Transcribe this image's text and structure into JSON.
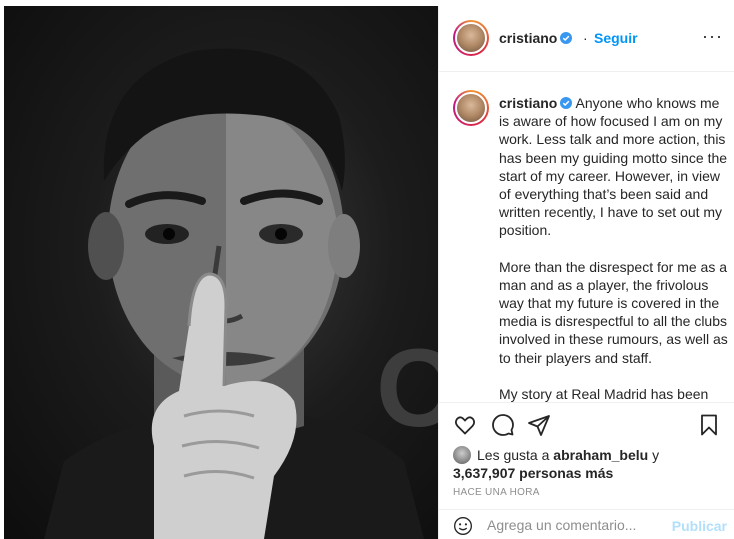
{
  "post": {
    "username": "cristiano",
    "follow_separator": "·",
    "follow_label": "Seguir",
    "more_label": "···",
    "caption": {
      "username": "cristiano",
      "paragraphs": [
        "Anyone who knows me is aware of how focused I am on my work. Less talk and more action, this has been my guiding motto since the start of my career. However, in view of everything that’s been said and written recently, I have to set out my position.",
        "More than the disrespect for me as a man and as a player, the frivolous way that my future is covered in the media is disrespectful to all the clubs involved in these rumours, as well as to their players and staff.",
        "My story at Real Madrid has been written. It’s been recorded. In words and numbers, in trophies and titles, in records and in headlines. It’s in the"
      ]
    },
    "likes": {
      "prefix": "Les gusta a",
      "liker": "abraham_belu",
      "connector": "y",
      "count": "3,637,907 personas más"
    },
    "timestamp": "HACE UNA HORA",
    "comment": {
      "placeholder": "Agrega un comentario...",
      "publish_label": "Publicar"
    },
    "photo": {
      "jersey_text": "O"
    },
    "colors": {
      "accent": "#0095f6",
      "publish_disabled": "#b2dffc",
      "verified": "#3897f0",
      "muted": "#8e8e8e"
    }
  }
}
